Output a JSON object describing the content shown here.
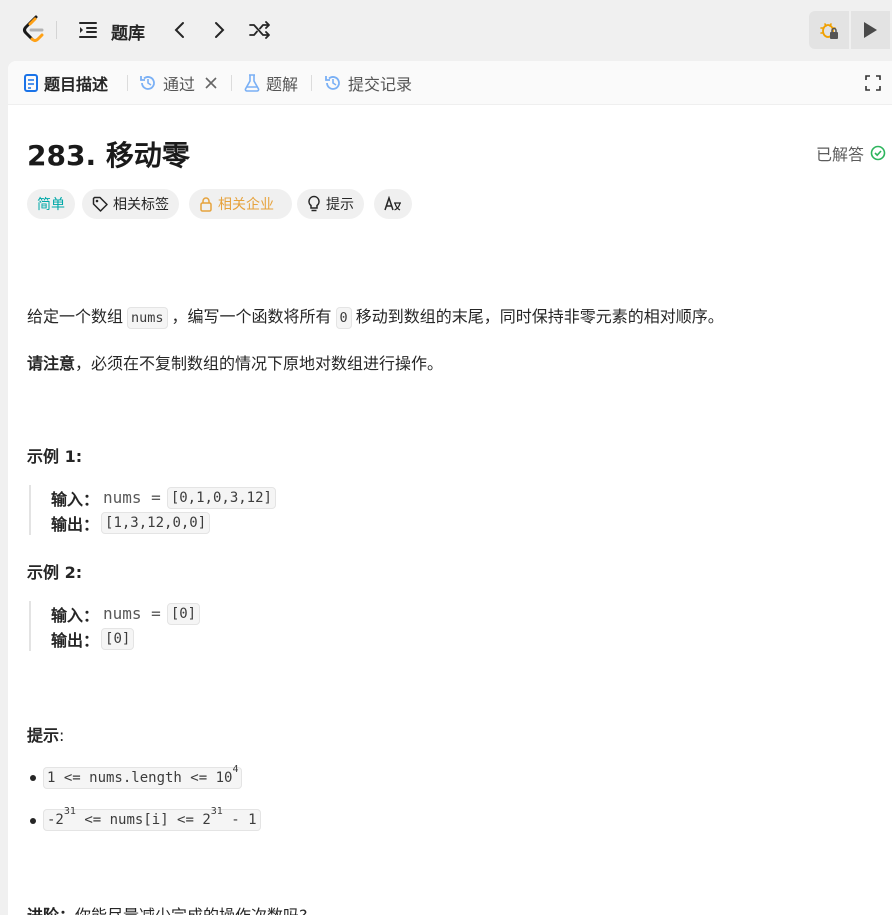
{
  "header": {
    "title": "题库",
    "icons": [
      "logo-icon",
      "list-icon",
      "chevron-left-icon",
      "chevron-right-icon",
      "shuffle-icon",
      "debug-locked-icon",
      "play-icon"
    ]
  },
  "tabs": [
    {
      "label": "题目描述",
      "icon": "description-icon",
      "active": true
    },
    {
      "label": "通过",
      "icon": "history-icon",
      "closable": true
    },
    {
      "label": "题解",
      "icon": "flask-icon"
    },
    {
      "label": "提交记录",
      "icon": "history-icon"
    }
  ],
  "problem": {
    "title": "283. 移动零",
    "status": "已解答",
    "tags": {
      "difficulty": "简单",
      "related_tags": "相关标签",
      "related_companies": "相关企业",
      "hint": "提示",
      "translate": "A文"
    },
    "desc1": {
      "before": "给定一个数组",
      "code1": "nums",
      "middle": "，编写一个函数将所有",
      "code2": "0",
      "after": "移动到数组的末尾，同时保持非零元素的相对顺序。"
    },
    "desc2": {
      "bold": "请注意",
      "rest": "，必须在不复制数组的情况下原地对数组进行操作。"
    },
    "examples": [
      {
        "heading": "示例 1:",
        "input_label": "输入：",
        "input_var": "nums =",
        "input": "[0,1,0,3,12]",
        "output_label": "输出：",
        "output": "[1,3,12,0,0]"
      },
      {
        "heading": "示例 2:",
        "input_label": "输入：",
        "input_var": "nums =",
        "input": "[0]",
        "output_label": "输出：",
        "output": "[0]"
      }
    ],
    "constraints_heading": "提示",
    "constraints_colon": ":",
    "constraints": [
      {
        "text": "1 <= nums.length <= 10",
        "sup": "4",
        "tail": ""
      },
      {
        "pre": "-2",
        "sup1": "31",
        "mid": " <= nums[i] <= 2",
        "sup2": "31",
        "tail": " - 1"
      }
    ],
    "followup": {
      "bold": "进阶：",
      "rest": "你能尽量减少完成的操作次数吗?"
    }
  },
  "colors": {
    "easy": "#00a8a8",
    "company": "#e6a23c",
    "solved_check": "#2db55d",
    "active_tab_icon": "#1a73e8"
  }
}
